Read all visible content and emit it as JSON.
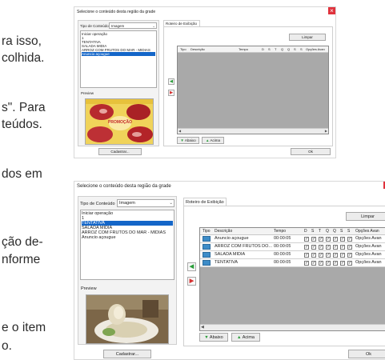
{
  "document_fragments": {
    "line1": "ra isso,",
    "line2": "colhida.",
    "line3": "s\". Para",
    "line4": "teúdos.",
    "line5": "dos em",
    "line6": "ção de-",
    "line7": "nforme",
    "line8": "e o item",
    "line9": "o."
  },
  "dialog_small": {
    "title": "Selecione o conteúdo desta região da grade",
    "close_glyph": "×",
    "tipo_label": "Tipo de Conteúdo",
    "tipo_value": "Imagem",
    "list_items": [
      "Iniciar operação",
      "1",
      "TENTATIVA",
      "SALADA MIDIA",
      "ARROZ COM FRUTOS DO MAR - MIDIAS",
      "Anuncio açougue"
    ],
    "selected_index": 5,
    "preview_label": "Preview",
    "preview_text": "PROMOÇÃO",
    "cadastrar_button": "Cadastrar...",
    "tab_label": "Roteiro de Exibição",
    "limpar_button": "Limpar",
    "columns": [
      "Tipo",
      "Descrição",
      "Tempo",
      "D",
      "S",
      "T",
      "Q",
      "Q",
      "S",
      "S",
      "Opções Avan"
    ],
    "abaixo_button": "Abaixo",
    "acima_button": "Acima",
    "ok_button": "Ok"
  },
  "dialog_large": {
    "title": "Selecione o conteúdo desta região da grade",
    "tipo_label": "Tipo de Conteúdo",
    "tipo_value": "Imagem",
    "list_items": [
      "Iniciar operação",
      "1",
      "TENTATIVA",
      "SALADA MIDIA",
      "ARROZ COM FRUTOS DO MAR - MIDIAS",
      "Anuncio açougue"
    ],
    "selected_index": 2,
    "preview_label": "Preview",
    "cadastrar_button": "Cadastrar...",
    "tab_label": "Roteiro de Exibição",
    "limpar_button": "Limpar",
    "columns": [
      "Tipo",
      "Descrição",
      "Tempo",
      "D",
      "S",
      "T",
      "Q",
      "Q",
      "S",
      "S",
      "Opções Avan"
    ],
    "rows": [
      {
        "descricao": "Anuncio açougue",
        "tempo": "00:00:05",
        "opcoes": "Opções Avan"
      },
      {
        "descricao": "ARROZ COM FRUTOS DO...",
        "tempo": "00:00:05",
        "opcoes": "Opções Avan"
      },
      {
        "descricao": "SALADA MIDIA",
        "tempo": "00:00:05",
        "opcoes": "Opções Avan"
      },
      {
        "descricao": "TENTATIVA",
        "tempo": "00:00:05",
        "opcoes": "Opções Avan"
      }
    ],
    "check_glyph": "✓",
    "abaixo_button": "Abaixo",
    "acima_button": "Acima",
    "ok_button": "Ok"
  },
  "icons": {
    "up_arrow_glyph": "▲",
    "down_arrow_glyph": "▼",
    "left_arrow_glyph": "◀",
    "right_arrow_glyph": "▶",
    "add_glyph": "◀",
    "remove_glyph": "▶"
  },
  "colors": {
    "selection": "#1466c8",
    "close": "#e0323c",
    "grid_empty": "#a9a9a9",
    "accent_green": "#2a9d3a",
    "accent_red": "#d63030"
  }
}
